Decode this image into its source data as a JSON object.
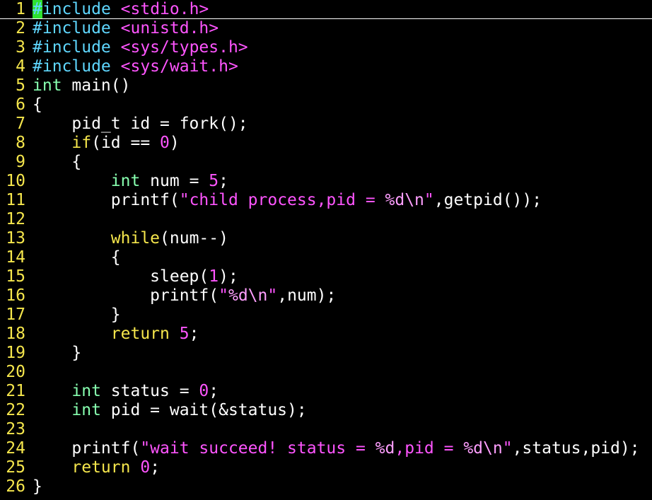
{
  "colors": {
    "background": "#000000",
    "line_number": "#f5e64c",
    "preproc": "#5fd7ff",
    "include_file": "#ff55ff",
    "type": "#87ffaf",
    "keyword": "#f5e64c",
    "number": "#ff55ff",
    "string": "#ff55ff",
    "special": "#ff9fff",
    "normal": "#ffffff",
    "cursor_bg": "#2fe02f"
  },
  "lines": [
    {
      "n": "1",
      "tokens": [
        {
          "t": "#",
          "k": "cursor"
        },
        {
          "t": "include",
          "k": "preproc"
        },
        {
          "t": " ",
          "k": "normal"
        },
        {
          "t": "<stdio.h>",
          "k": "include_file"
        }
      ]
    },
    {
      "n": "2",
      "tokens": [
        {
          "t": "#include",
          "k": "preproc"
        },
        {
          "t": " ",
          "k": "normal"
        },
        {
          "t": "<unistd.h>",
          "k": "include_file"
        }
      ]
    },
    {
      "n": "3",
      "tokens": [
        {
          "t": "#include",
          "k": "preproc"
        },
        {
          "t": " ",
          "k": "normal"
        },
        {
          "t": "<sys/types.h>",
          "k": "include_file"
        }
      ]
    },
    {
      "n": "4",
      "tokens": [
        {
          "t": "#include",
          "k": "preproc"
        },
        {
          "t": " ",
          "k": "normal"
        },
        {
          "t": "<sys/wait.h>",
          "k": "include_file"
        }
      ]
    },
    {
      "n": "5",
      "tokens": [
        {
          "t": "int",
          "k": "type"
        },
        {
          "t": " main()",
          "k": "normal"
        }
      ]
    },
    {
      "n": "6",
      "tokens": [
        {
          "t": "{",
          "k": "normal"
        }
      ]
    },
    {
      "n": "7",
      "tokens": [
        {
          "t": "    pid_t id = fork();",
          "k": "normal"
        }
      ]
    },
    {
      "n": "8",
      "tokens": [
        {
          "t": "    ",
          "k": "normal"
        },
        {
          "t": "if",
          "k": "keyword"
        },
        {
          "t": "(id == ",
          "k": "normal"
        },
        {
          "t": "0",
          "k": "number"
        },
        {
          "t": ")",
          "k": "normal"
        }
      ]
    },
    {
      "n": "9",
      "tokens": [
        {
          "t": "    {",
          "k": "normal"
        }
      ]
    },
    {
      "n": "10",
      "tokens": [
        {
          "t": "        ",
          "k": "normal"
        },
        {
          "t": "int",
          "k": "type"
        },
        {
          "t": " num = ",
          "k": "normal"
        },
        {
          "t": "5",
          "k": "number"
        },
        {
          "t": ";",
          "k": "normal"
        }
      ]
    },
    {
      "n": "11",
      "tokens": [
        {
          "t": "        printf(",
          "k": "normal"
        },
        {
          "t": "\"child process,pid = ",
          "k": "string"
        },
        {
          "t": "%d\\n",
          "k": "special"
        },
        {
          "t": "\"",
          "k": "string"
        },
        {
          "t": ",getpid());",
          "k": "normal"
        }
      ]
    },
    {
      "n": "12",
      "tokens": []
    },
    {
      "n": "13",
      "tokens": [
        {
          "t": "        ",
          "k": "normal"
        },
        {
          "t": "while",
          "k": "keyword"
        },
        {
          "t": "(num--)",
          "k": "normal"
        }
      ]
    },
    {
      "n": "14",
      "tokens": [
        {
          "t": "        {",
          "k": "normal"
        }
      ]
    },
    {
      "n": "15",
      "tokens": [
        {
          "t": "            sleep(",
          "k": "normal"
        },
        {
          "t": "1",
          "k": "number"
        },
        {
          "t": ");",
          "k": "normal"
        }
      ]
    },
    {
      "n": "16",
      "tokens": [
        {
          "t": "            printf(",
          "k": "normal"
        },
        {
          "t": "\"",
          "k": "string"
        },
        {
          "t": "%d\\n",
          "k": "special"
        },
        {
          "t": "\"",
          "k": "string"
        },
        {
          "t": ",num);",
          "k": "normal"
        }
      ]
    },
    {
      "n": "17",
      "tokens": [
        {
          "t": "        }",
          "k": "normal"
        }
      ]
    },
    {
      "n": "18",
      "tokens": [
        {
          "t": "        ",
          "k": "normal"
        },
        {
          "t": "return",
          "k": "keyword"
        },
        {
          "t": " ",
          "k": "normal"
        },
        {
          "t": "5",
          "k": "number"
        },
        {
          "t": ";",
          "k": "normal"
        }
      ]
    },
    {
      "n": "19",
      "tokens": [
        {
          "t": "    }",
          "k": "normal"
        }
      ]
    },
    {
      "n": "20",
      "tokens": []
    },
    {
      "n": "21",
      "tokens": [
        {
          "t": "    ",
          "k": "normal"
        },
        {
          "t": "int",
          "k": "type"
        },
        {
          "t": " status = ",
          "k": "normal"
        },
        {
          "t": "0",
          "k": "number"
        },
        {
          "t": ";",
          "k": "normal"
        }
      ]
    },
    {
      "n": "22",
      "tokens": [
        {
          "t": "    ",
          "k": "normal"
        },
        {
          "t": "int",
          "k": "type"
        },
        {
          "t": " pid = wait(&status);",
          "k": "normal"
        }
      ]
    },
    {
      "n": "23",
      "tokens": []
    },
    {
      "n": "24",
      "tokens": [
        {
          "t": "    printf(",
          "k": "normal"
        },
        {
          "t": "\"wait succeed! status = ",
          "k": "string"
        },
        {
          "t": "%d",
          "k": "special"
        },
        {
          "t": ",pid = ",
          "k": "string"
        },
        {
          "t": "%d\\n",
          "k": "special"
        },
        {
          "t": "\"",
          "k": "string"
        },
        {
          "t": ",status,pid);",
          "k": "normal"
        }
      ]
    },
    {
      "n": "25",
      "tokens": [
        {
          "t": "    ",
          "k": "normal"
        },
        {
          "t": "return",
          "k": "keyword"
        },
        {
          "t": " ",
          "k": "normal"
        },
        {
          "t": "0",
          "k": "number"
        },
        {
          "t": ";",
          "k": "normal"
        }
      ]
    },
    {
      "n": "26",
      "tokens": [
        {
          "t": "}",
          "k": "normal"
        }
      ]
    }
  ]
}
